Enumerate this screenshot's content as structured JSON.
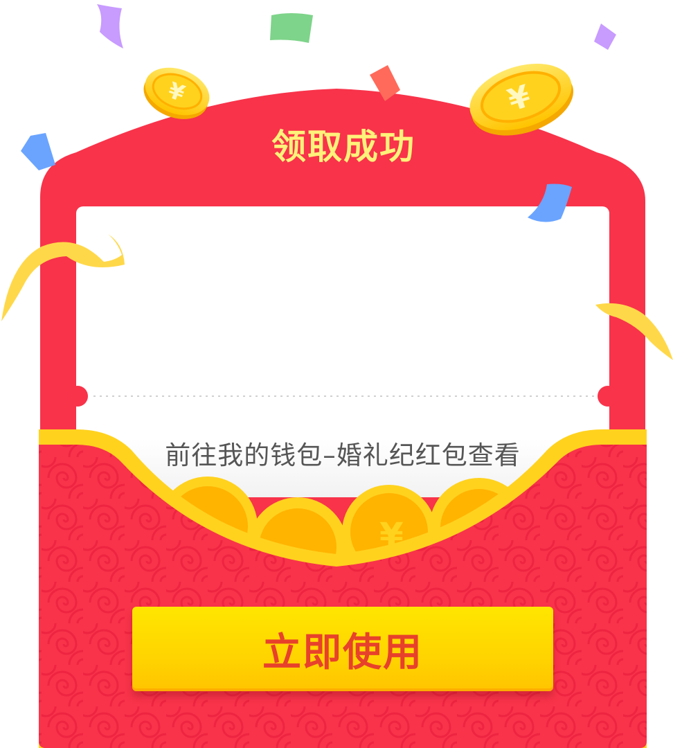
{
  "dialog": {
    "title": "领取成功",
    "hint": "前往我的钱包–婚礼纪红包查看",
    "use_button_label": "立即使用"
  },
  "colors": {
    "envelope_red": "#F8334A",
    "gold": "#FFD21E",
    "title_yellow": "#FFF27A",
    "button_text": "#E8412B"
  },
  "icons": {
    "coin": "coin-icon",
    "confetti": "confetti-icon",
    "ribbon": "ribbon-icon"
  }
}
